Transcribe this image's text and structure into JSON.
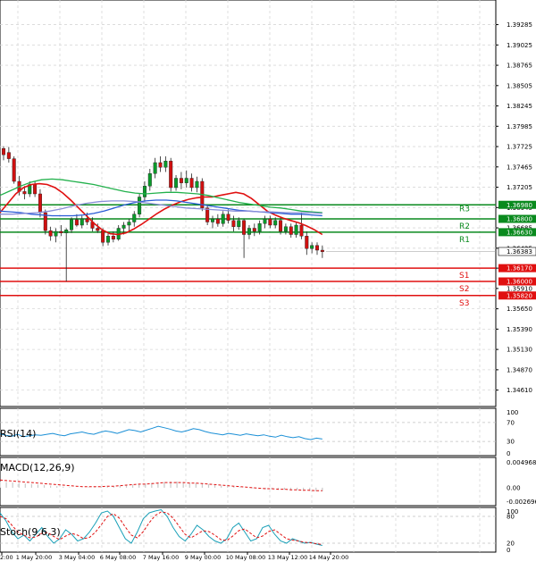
{
  "chart_data": [
    {
      "type": "candlestick",
      "panel": "main",
      "ylim": [
        1.344,
        1.396
      ],
      "y_ticks": [
        "1.39285",
        "1.39025",
        "1.38765",
        "1.38505",
        "1.38245",
        "1.37985",
        "1.37725",
        "1.37465",
        "1.37205",
        "1.36945",
        "1.36685",
        "1.36425",
        "1.36170",
        "1.35910",
        "1.35650",
        "1.35390",
        "1.35130",
        "1.34870",
        "1.34610"
      ],
      "x_tick_labels": [
        "2:00",
        "1 May 20:00",
        "3 May 04:00",
        "6 May 08:00",
        "7 May 16:00",
        "9 May 00:00",
        "10 May 08:00",
        "13 May 12:00",
        "14 May 20:00"
      ],
      "candles": [
        {
          "o": 1.377,
          "h": 1.3773,
          "l": 1.3755,
          "c": 1.3762
        },
        {
          "o": 1.3765,
          "h": 1.3772,
          "l": 1.3752,
          "c": 1.3757
        },
        {
          "o": 1.3757,
          "h": 1.376,
          "l": 1.3725,
          "c": 1.3728
        },
        {
          "o": 1.3728,
          "h": 1.3735,
          "l": 1.371,
          "c": 1.3715
        },
        {
          "o": 1.3715,
          "h": 1.3722,
          "l": 1.3705,
          "c": 1.3712
        },
        {
          "o": 1.3712,
          "h": 1.3728,
          "l": 1.3708,
          "c": 1.3724
        },
        {
          "o": 1.3724,
          "h": 1.3728,
          "l": 1.3708,
          "c": 1.3712
        },
        {
          "o": 1.3712,
          "h": 1.3718,
          "l": 1.3682,
          "c": 1.3688
        },
        {
          "o": 1.3688,
          "h": 1.3692,
          "l": 1.366,
          "c": 1.3665
        },
        {
          "o": 1.3665,
          "h": 1.367,
          "l": 1.3652,
          "c": 1.3658
        },
        {
          "o": 1.3658,
          "h": 1.3668,
          "l": 1.365,
          "c": 1.3664
        },
        {
          "o": 1.3664,
          "h": 1.3672,
          "l": 1.3658,
          "c": 1.3662
        },
        {
          "o": 1.3662,
          "h": 1.3668,
          "l": 1.36,
          "c": 1.3666
        },
        {
          "o": 1.3666,
          "h": 1.3682,
          "l": 1.3662,
          "c": 1.3679
        },
        {
          "o": 1.3679,
          "h": 1.3686,
          "l": 1.367,
          "c": 1.3672
        },
        {
          "o": 1.3672,
          "h": 1.3684,
          "l": 1.3668,
          "c": 1.368
        },
        {
          "o": 1.368,
          "h": 1.3688,
          "l": 1.3672,
          "c": 1.3676
        },
        {
          "o": 1.3676,
          "h": 1.3682,
          "l": 1.3664,
          "c": 1.3668
        },
        {
          "o": 1.3668,
          "h": 1.3674,
          "l": 1.3662,
          "c": 1.3665
        },
        {
          "o": 1.3665,
          "h": 1.3668,
          "l": 1.3645,
          "c": 1.365
        },
        {
          "o": 1.365,
          "h": 1.3662,
          "l": 1.3646,
          "c": 1.3658
        },
        {
          "o": 1.3658,
          "h": 1.3664,
          "l": 1.365,
          "c": 1.3654
        },
        {
          "o": 1.3654,
          "h": 1.3672,
          "l": 1.3652,
          "c": 1.3668
        },
        {
          "o": 1.3668,
          "h": 1.3676,
          "l": 1.366,
          "c": 1.3672
        },
        {
          "o": 1.3672,
          "h": 1.368,
          "l": 1.3664,
          "c": 1.3676
        },
        {
          "o": 1.3676,
          "h": 1.369,
          "l": 1.367,
          "c": 1.3686
        },
        {
          "o": 1.3686,
          "h": 1.3712,
          "l": 1.3682,
          "c": 1.3708
        },
        {
          "o": 1.3708,
          "h": 1.3728,
          "l": 1.3702,
          "c": 1.3722
        },
        {
          "o": 1.3722,
          "h": 1.3744,
          "l": 1.3716,
          "c": 1.3738
        },
        {
          "o": 1.3738,
          "h": 1.3758,
          "l": 1.3732,
          "c": 1.3752
        },
        {
          "o": 1.3752,
          "h": 1.376,
          "l": 1.374,
          "c": 1.3746
        },
        {
          "o": 1.3746,
          "h": 1.376,
          "l": 1.374,
          "c": 1.3754
        },
        {
          "o": 1.3754,
          "h": 1.3758,
          "l": 1.3715,
          "c": 1.372
        },
        {
          "o": 1.372,
          "h": 1.3736,
          "l": 1.3716,
          "c": 1.3732
        },
        {
          "o": 1.3732,
          "h": 1.374,
          "l": 1.3718,
          "c": 1.3726
        },
        {
          "o": 1.3726,
          "h": 1.3742,
          "l": 1.372,
          "c": 1.3732
        },
        {
          "o": 1.3732,
          "h": 1.3738,
          "l": 1.3715,
          "c": 1.372
        },
        {
          "o": 1.372,
          "h": 1.3734,
          "l": 1.3714,
          "c": 1.3728
        },
        {
          "o": 1.3728,
          "h": 1.3732,
          "l": 1.369,
          "c": 1.3694
        },
        {
          "o": 1.3694,
          "h": 1.3698,
          "l": 1.3672,
          "c": 1.3676
        },
        {
          "o": 1.3676,
          "h": 1.3684,
          "l": 1.3668,
          "c": 1.368
        },
        {
          "o": 1.368,
          "h": 1.3686,
          "l": 1.367,
          "c": 1.3674
        },
        {
          "o": 1.3674,
          "h": 1.369,
          "l": 1.367,
          "c": 1.3686
        },
        {
          "o": 1.3686,
          "h": 1.3692,
          "l": 1.3674,
          "c": 1.3678
        },
        {
          "o": 1.3678,
          "h": 1.3684,
          "l": 1.3664,
          "c": 1.367
        },
        {
          "o": 1.367,
          "h": 1.3682,
          "l": 1.3666,
          "c": 1.3678
        },
        {
          "o": 1.3678,
          "h": 1.368,
          "l": 1.363,
          "c": 1.366
        },
        {
          "o": 1.366,
          "h": 1.3672,
          "l": 1.3654,
          "c": 1.3668
        },
        {
          "o": 1.3668,
          "h": 1.3674,
          "l": 1.3658,
          "c": 1.3664
        },
        {
          "o": 1.3664,
          "h": 1.3678,
          "l": 1.366,
          "c": 1.3674
        },
        {
          "o": 1.3674,
          "h": 1.3684,
          "l": 1.3668,
          "c": 1.368
        },
        {
          "o": 1.368,
          "h": 1.3684,
          "l": 1.3668,
          "c": 1.3672
        },
        {
          "o": 1.3672,
          "h": 1.3682,
          "l": 1.3668,
          "c": 1.3678
        },
        {
          "o": 1.3678,
          "h": 1.3682,
          "l": 1.366,
          "c": 1.3664
        },
        {
          "o": 1.3664,
          "h": 1.3674,
          "l": 1.366,
          "c": 1.367
        },
        {
          "o": 1.367,
          "h": 1.3674,
          "l": 1.3656,
          "c": 1.366
        },
        {
          "o": 1.366,
          "h": 1.3676,
          "l": 1.3656,
          "c": 1.3672
        },
        {
          "o": 1.3672,
          "h": 1.3688,
          "l": 1.3654,
          "c": 1.3658
        },
        {
          "o": 1.3658,
          "h": 1.3664,
          "l": 1.3634,
          "c": 1.3642
        },
        {
          "o": 1.3642,
          "h": 1.365,
          "l": 1.3636,
          "c": 1.3646
        },
        {
          "o": 1.3646,
          "h": 1.365,
          "l": 1.3634,
          "c": 1.364
        },
        {
          "o": 1.364,
          "h": 1.3646,
          "l": 1.363,
          "c": 1.3638
        }
      ],
      "series": [
        {
          "color": "#e01010",
          "values": [
            1.3688,
            1.37,
            1.3712,
            1.372,
            1.3724,
            1.3725,
            1.3724,
            1.372,
            1.3713,
            1.3704,
            1.3694,
            1.3684,
            1.3674,
            1.3666,
            1.3661,
            1.366,
            1.3662,
            1.3667,
            1.3673,
            1.368,
            1.3687,
            1.3693,
            1.3698,
            1.3702,
            1.3705,
            1.3707,
            1.3708,
            1.3708,
            1.371,
            1.3712,
            1.3714,
            1.3712,
            1.3706,
            1.3698,
            1.369,
            1.3685,
            1.3681,
            1.3678,
            1.3675,
            1.3671,
            1.3666,
            1.366
          ]
        },
        {
          "color": "#22b14c",
          "values": [
            1.371,
            1.3716,
            1.3722,
            1.3727,
            1.373,
            1.3731,
            1.373,
            1.3728,
            1.3726,
            1.3724,
            1.3721,
            1.3718,
            1.3715,
            1.3713,
            1.3712,
            1.3713,
            1.3714,
            1.3714,
            1.3713,
            1.3712,
            1.371,
            1.3707,
            1.3704,
            1.3701,
            1.3699,
            1.3697,
            1.3695,
            1.3694,
            1.3692,
            1.369,
            1.3689,
            1.3688
          ]
        },
        {
          "color": "#2a5cd6",
          "values": [
            1.369,
            1.3689,
            1.3688,
            1.3686,
            1.3685,
            1.3684,
            1.3684,
            1.3684,
            1.3685,
            1.3687,
            1.369,
            1.3694,
            1.3698,
            1.3701,
            1.3703,
            1.3704,
            1.3704,
            1.3703,
            1.3701,
            1.3699,
            1.3697,
            1.3695,
            1.3693,
            1.3691,
            1.369,
            1.3689,
            1.3688,
            1.3687,
            1.3686,
            1.3686,
            1.3685,
            1.3684
          ]
        },
        {
          "color": "#8a8fd8",
          "values": [
            1.3686,
            1.3686,
            1.3687,
            1.3688,
            1.369,
            1.3693,
            1.3697,
            1.37,
            1.3702,
            1.3703,
            1.3703,
            1.3702,
            1.37,
            1.3698,
            1.3696,
            1.3694,
            1.3693,
            1.3692,
            1.3691,
            1.369,
            1.369,
            1.3689,
            1.3689,
            1.3688,
            1.3688,
            1.3688,
            1.3687
          ]
        }
      ],
      "levels": [
        {
          "label": "R3",
          "value": 1.3698,
          "value_label": "1.36980",
          "color": "#0a8a1e"
        },
        {
          "label": "R2",
          "value": 1.368,
          "value_label": "1.36800",
          "color": "#0a8a1e"
        },
        {
          "label": "R1",
          "value": 1.3663,
          "value_label": "1.36630",
          "color": "#0a8a1e"
        },
        {
          "label": "S1",
          "value": 1.3617,
          "value_label": "1.36170",
          "color": "#e01010"
        },
        {
          "label": "S2",
          "value": 1.36,
          "value_label": "1.36000",
          "color": "#e01010"
        },
        {
          "label": "S3",
          "value": 1.3582,
          "value_label": "1.35820",
          "color": "#e01010"
        }
      ],
      "current_price": {
        "value": 1.36383,
        "label": "1.36383"
      },
      "grid": true
    },
    {
      "type": "line",
      "panel": "rsi",
      "title": "RSI(14)",
      "ylim": [
        0,
        100
      ],
      "y_ticks": [
        "100",
        "70",
        "30",
        "0"
      ],
      "series": [
        {
          "color": "#1a8fd6",
          "values": [
            46,
            43,
            41,
            45,
            40,
            42,
            44,
            43,
            45,
            47,
            44,
            42,
            46,
            48,
            50,
            47,
            45,
            49,
            52,
            50,
            47,
            51,
            55,
            53,
            50,
            54,
            58,
            62,
            59,
            56,
            52,
            50,
            53,
            57,
            55,
            51,
            48,
            46,
            44,
            47,
            45,
            43,
            46,
            44,
            42,
            44,
            41,
            39,
            43,
            40,
            38,
            40,
            36,
            34,
            37,
            35
          ]
        }
      ],
      "grid": true
    },
    {
      "type": "bar",
      "panel": "macd",
      "title": "MACD(12,26,9)",
      "ylim": [
        -0.0035,
        0.0059
      ],
      "y_ticks": [
        "0.004968",
        "0.00",
        "-0.002696"
      ],
      "values": [
        0.0012,
        0.0011,
        0.001,
        0.0009,
        0.0008,
        0.0007,
        0.0006,
        0.0005,
        0.0004,
        0.0003,
        0.0002,
        0.0001,
        0.0,
        0.0,
        0.0001,
        0.0001,
        0.0002,
        0.0002,
        0.0003,
        0.0004,
        0.0005,
        0.0006,
        0.0007,
        0.0008,
        0.0009,
        0.001,
        0.0011,
        0.0012,
        0.0012,
        0.0011,
        0.001,
        0.0009,
        0.0008,
        0.0007,
        0.0005,
        0.0004,
        0.0003,
        0.0002,
        0.0001,
        0.0,
        -0.0001,
        -0.0002,
        -0.0003,
        -0.0003,
        -0.0004,
        -0.0004,
        -0.0005,
        -0.0005,
        -0.0006,
        -0.0006,
        -0.0007,
        -0.0007
      ],
      "signal": [
        0.0015,
        0.0014,
        0.0013,
        0.0012,
        0.0011,
        0.001,
        0.0009,
        0.0008,
        0.0007,
        0.0006,
        0.0005,
        0.0004,
        0.0003,
        0.0002,
        0.0002,
        0.0002,
        0.0002,
        0.0003,
        0.0003,
        0.0004,
        0.0005,
        0.0006,
        0.0007,
        0.0007,
        0.0008,
        0.0009,
        0.001,
        0.001,
        0.001,
        0.001,
        0.0009,
        0.0009,
        0.0008,
        0.0007,
        0.0006,
        0.0005,
        0.0004,
        0.0003,
        0.0002,
        0.0001,
        0.0,
        -0.0001,
        -0.0002,
        -0.0002,
        -0.0003,
        -0.0003,
        -0.0004,
        -0.0004,
        -0.0005,
        -0.0005,
        -0.0006,
        -0.0006
      ],
      "bar_color": "#c8c8c8",
      "signal_color": "#e01010",
      "grid": true
    },
    {
      "type": "line",
      "panel": "stoch",
      "title": "Stoch(9,6,3)",
      "ylim": [
        0,
        100
      ],
      "y_ticks": [
        "100",
        "80",
        "20",
        "0"
      ],
      "series": [
        {
          "color": "#1aa0b8",
          "values": [
            88,
            70,
            45,
            30,
            38,
            25,
            40,
            55,
            35,
            20,
            30,
            50,
            40,
            25,
            30,
            45,
            65,
            88,
            92,
            80,
            55,
            30,
            20,
            45,
            75,
            88,
            92,
            95,
            80,
            55,
            35,
            25,
            40,
            60,
            50,
            35,
            25,
            20,
            30,
            55,
            65,
            45,
            25,
            30,
            55,
            60,
            40,
            25,
            20,
            30,
            25,
            20,
            22,
            18,
            15
          ]
        },
        {
          "color": "#e01010",
          "values": [
            80,
            75,
            60,
            45,
            38,
            32,
            34,
            42,
            44,
            35,
            28,
            36,
            42,
            38,
            30,
            33,
            45,
            62,
            80,
            86,
            76,
            56,
            38,
            32,
            46,
            66,
            82,
            90,
            88,
            76,
            58,
            40,
            32,
            40,
            48,
            46,
            38,
            28,
            26,
            36,
            48,
            52,
            42,
            32,
            36,
            46,
            50,
            40,
            30,
            27,
            25,
            22,
            21,
            19,
            17
          ],
          "dashed": true
        }
      ],
      "grid": true
    }
  ]
}
